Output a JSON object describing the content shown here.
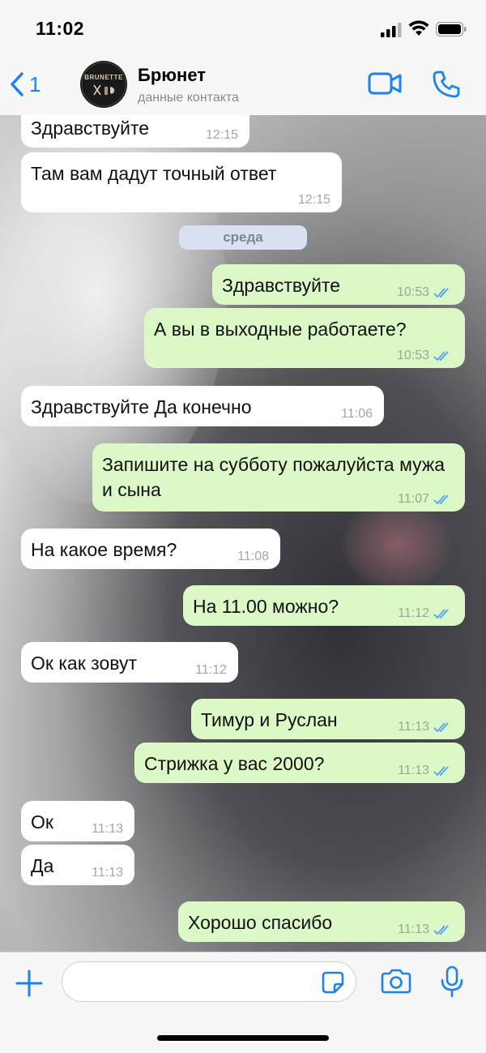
{
  "status_bar": {
    "time": "11:02"
  },
  "header": {
    "back_count": "1",
    "avatar_text": "BRUNETTE",
    "contact_name": "Брюнет",
    "contact_subtitle": "данные контакта"
  },
  "date_separator": "среда",
  "messages": [
    {
      "direction": "in",
      "text": "Здравствуйте",
      "time": "12:15"
    },
    {
      "direction": "in",
      "text": "Там вам дадут точный ответ",
      "time": "12:15"
    },
    {
      "direction": "out",
      "text": "Здравствуйте",
      "time": "10:53",
      "read": true
    },
    {
      "direction": "out",
      "text": "А вы в выходные работаете?",
      "time": "10:53",
      "read": true
    },
    {
      "direction": "in",
      "text": "Здравствуйте Да конечно",
      "time": "11:06"
    },
    {
      "direction": "out",
      "text": "Запишите на субботу пожалуйста мужа и сына",
      "time": "11:07",
      "read": true
    },
    {
      "direction": "in",
      "text": "На какое время?",
      "time": "11:08"
    },
    {
      "direction": "out",
      "text": "На 11.00 можно?",
      "time": "11:12",
      "read": true
    },
    {
      "direction": "in",
      "text": "Ок как зовут",
      "time": "11:12"
    },
    {
      "direction": "out",
      "text": "Тимур и Руслан",
      "time": "11:13",
      "read": true
    },
    {
      "direction": "out",
      "text": "Стрижка у вас 2000?",
      "time": "11:13",
      "read": true
    },
    {
      "direction": "in",
      "text": "Ок",
      "time": "11:13"
    },
    {
      "direction": "in",
      "text": "Да",
      "time": "11:13"
    },
    {
      "direction": "out",
      "text": "Хорошо спасибо",
      "time": "11:13",
      "read": true
    }
  ],
  "composer": {
    "placeholder": ""
  },
  "icons": {
    "back": "chevron-left-icon",
    "video": "video-camera-icon",
    "call": "phone-icon",
    "attach": "plus-icon",
    "sticker": "sticker-icon",
    "camera": "camera-icon",
    "mic": "microphone-icon"
  },
  "colors": {
    "accent": "#1b82f5",
    "incoming_bubble": "#ffffff",
    "outgoing_bubble": "#dcf8c6",
    "read_ticks": "#4fa3f7"
  }
}
